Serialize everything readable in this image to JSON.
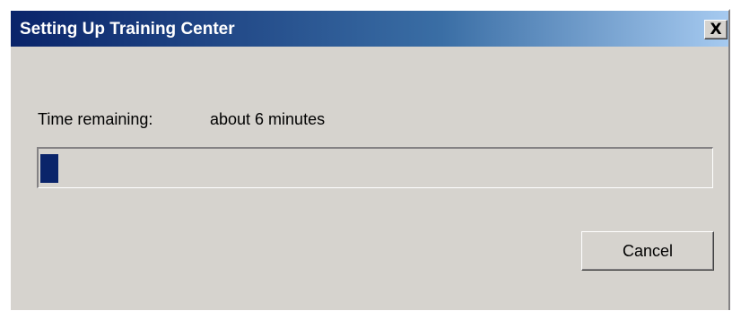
{
  "window": {
    "title": "Setting Up Training Center",
    "close_label": "X"
  },
  "status": {
    "time_label": "Time remaining:",
    "time_value": "about 6 minutes"
  },
  "progress": {
    "percent": 3
  },
  "buttons": {
    "cancel_label": "Cancel"
  },
  "colors": {
    "title_gradient_start": "#0a246a",
    "title_gradient_end": "#a6caf0",
    "dialog_bg": "#d6d3ce",
    "progress_fill": "#0a246a"
  }
}
